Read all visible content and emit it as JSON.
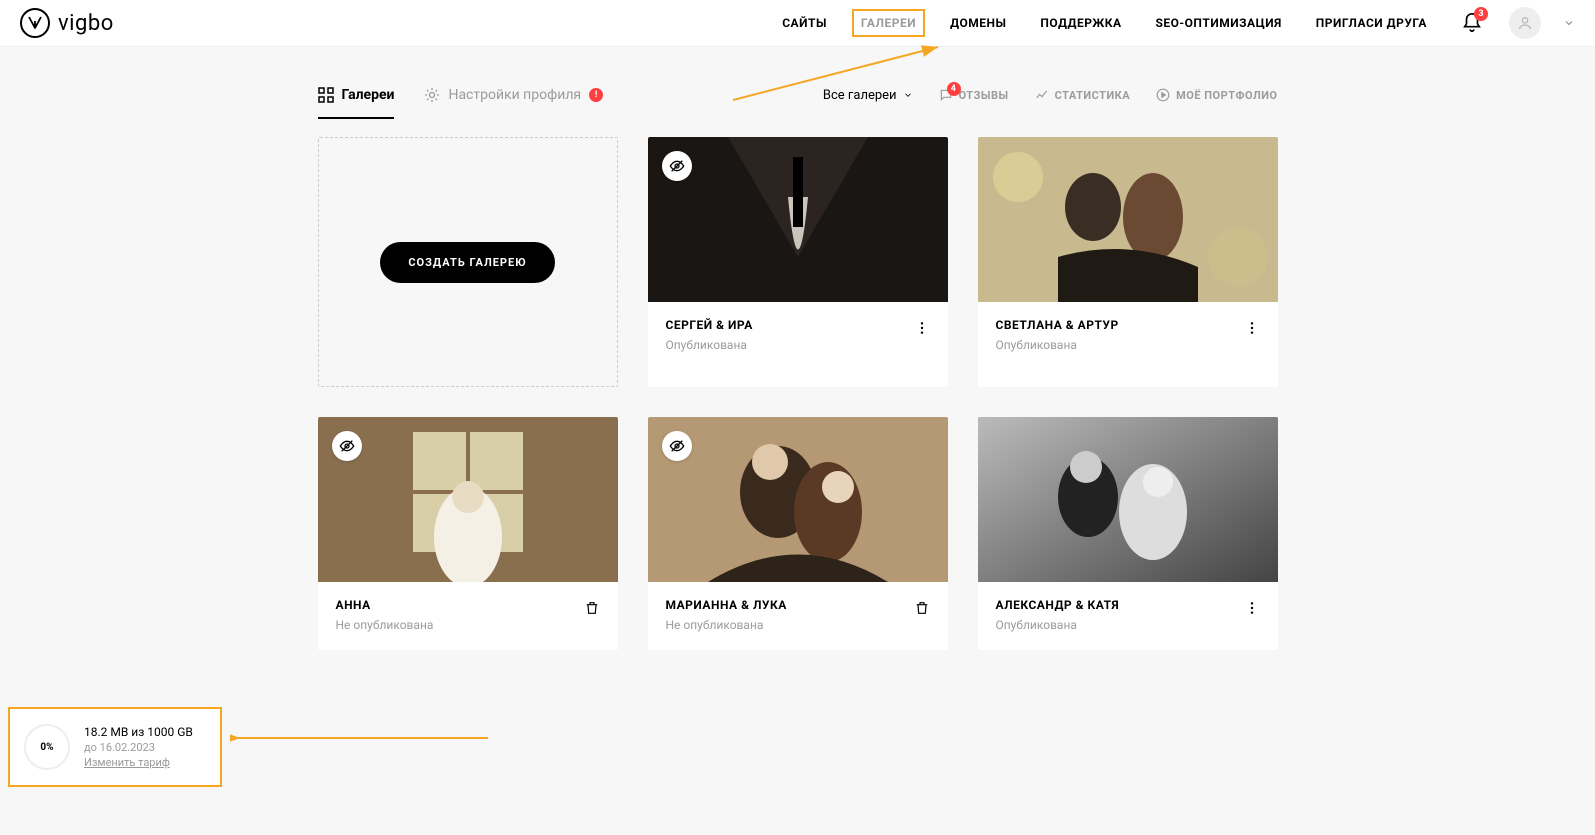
{
  "brand": {
    "name": "vigbo"
  },
  "nav": {
    "sites": "САЙТЫ",
    "galleries": "ГАЛЕРЕИ",
    "domains": "ДОМЕНЫ",
    "support": "ПОДДЕРЖКА",
    "seo": "SEO-ОПТИМИЗАЦИЯ",
    "invite": "ПРИГЛАСИ ДРУГА",
    "bell_badge": "3"
  },
  "tabs": {
    "galleries": "Галереи",
    "profile": "Настройки профиля"
  },
  "filters": {
    "all_label": "Все галереи",
    "reviews": "ОТЗЫВЫ",
    "reviews_badge": "4",
    "stats": "СТАТИСТИКА",
    "portfolio": "МОЁ ПОРТФОЛИО"
  },
  "create_button": "СОЗДАТЬ ГАЛЕРЕЮ",
  "cards": [
    {
      "title": "СЕРГЕЙ & ИРА",
      "status": "Опубликована",
      "hidden": true,
      "action": "more"
    },
    {
      "title": "СВЕТЛАНА & АРТУР",
      "status": "Опубликована",
      "hidden": false,
      "action": "more"
    },
    {
      "title": "АННА",
      "status": "Не опубликована",
      "hidden": true,
      "action": "trash"
    },
    {
      "title": "МАРИАННА & ЛУКА",
      "status": "Не опубликована",
      "hidden": true,
      "action": "trash"
    },
    {
      "title": "АЛЕКСАНДР & КАТЯ",
      "status": "Опубликована",
      "hidden": false,
      "action": "more"
    }
  ],
  "storage": {
    "percent": "0%",
    "usage": "18.2 MB из 1000 GB",
    "until": "до 16.02.2023",
    "change": "Изменить тариф"
  }
}
